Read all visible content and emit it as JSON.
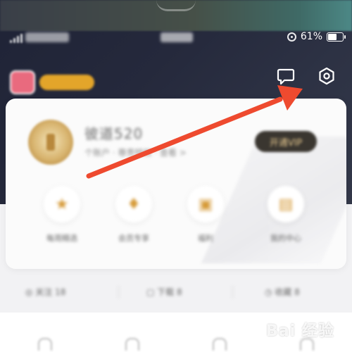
{
  "status_bar": {
    "battery_text": "61%",
    "battery_level": 0.61
  },
  "header": {
    "chat_icon": "chat-bubble-icon",
    "settings_icon": "settings-gear-icon"
  },
  "profile": {
    "name": "彼道520",
    "subtitle": "个账户 · 尊贵特权 · 查看 >",
    "vip_button": "开通VIP"
  },
  "features": [
    {
      "label": "每周精选",
      "icon": "★"
    },
    {
      "label": "会员专享",
      "icon": "♦"
    },
    {
      "label": "福利",
      "icon": "▣"
    },
    {
      "label": "我的中心",
      "icon": "▤"
    }
  ],
  "stats": [
    {
      "label": "◎ 关注 18"
    },
    {
      "label": "▢ 下载 8"
    },
    {
      "label": "◷ 收藏 8"
    }
  ],
  "watermark": "Bai 经验",
  "annotation": {
    "arrow_color": "#ee4a2f"
  }
}
